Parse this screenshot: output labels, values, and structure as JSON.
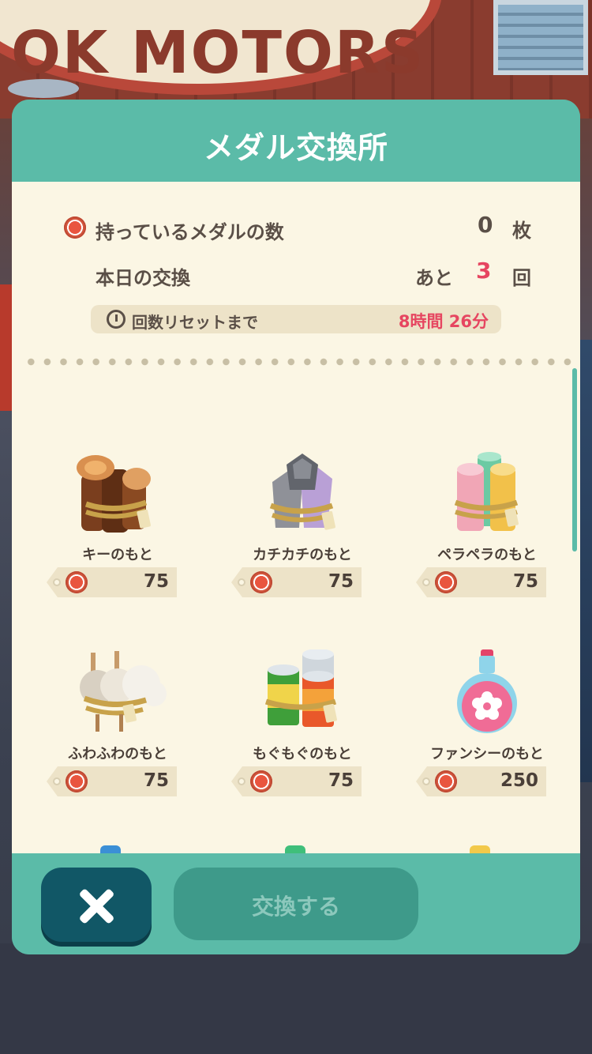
{
  "background": {
    "sign_text": "OK MOTORS"
  },
  "dialog": {
    "title": "メダル交換所",
    "medals_label": "持っているメダルの数",
    "medals_count": "0",
    "medals_unit": "枚",
    "today_label": "本日の交換",
    "today_prefix": "あと",
    "today_remaining": "3",
    "today_unit": "回",
    "reset_label": "回数リセットまで",
    "reset_time": "8時間 26分"
  },
  "items": [
    {
      "name": "キーのもと",
      "price": "75",
      "icon": "wood-logs-icon"
    },
    {
      "name": "カチカチのもと",
      "price": "75",
      "icon": "stone-crystals-icon"
    },
    {
      "name": "ペラペラのもと",
      "price": "75",
      "icon": "paper-rolls-icon"
    },
    {
      "name": "ふわふわのもと",
      "price": "75",
      "icon": "wool-cotton-icon"
    },
    {
      "name": "もぐもぐのもと",
      "price": "75",
      "icon": "canned-food-icon"
    },
    {
      "name": "ファンシーのもと",
      "price": "250",
      "icon": "pink-potion-icon"
    }
  ],
  "footer": {
    "close_icon": "close-icon",
    "exchange_label": "交換する"
  },
  "colors": {
    "accent": "#5bbba8",
    "panel": "#fbf6e4",
    "highlight": "#e64560",
    "close_button": "#115766"
  }
}
